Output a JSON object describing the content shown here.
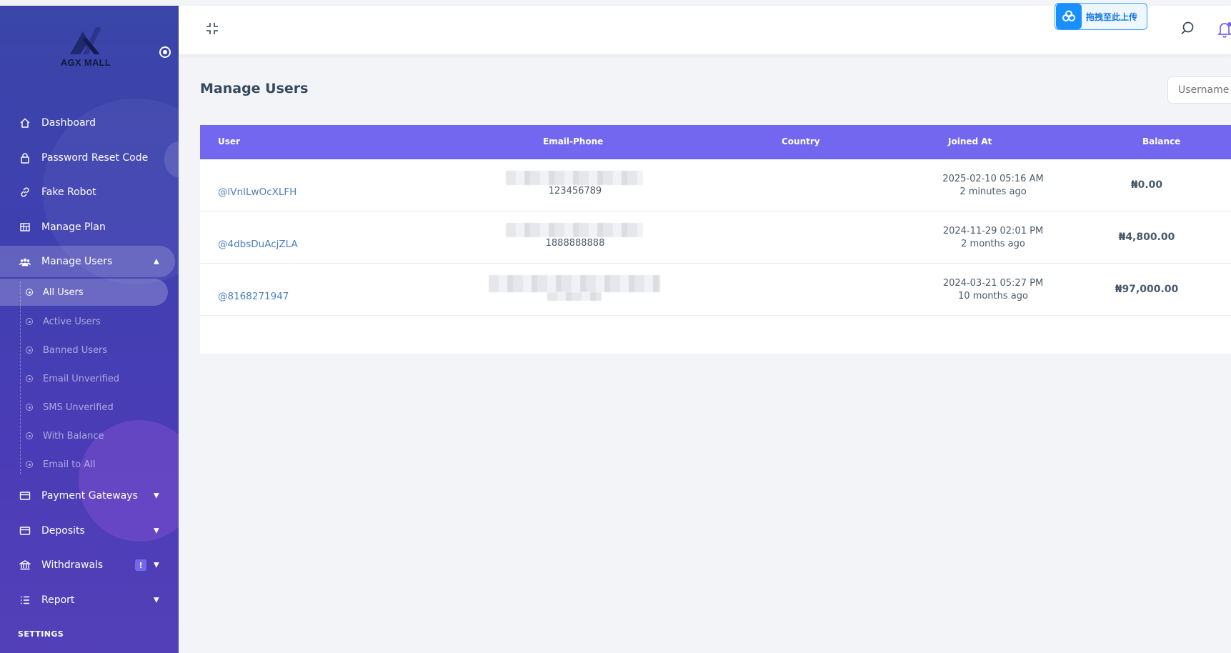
{
  "brand": {
    "name": "AGX MALL"
  },
  "sidebar": {
    "items": [
      {
        "label": "Dashboard",
        "icon": "home-icon"
      },
      {
        "label": "Password Reset Code",
        "icon": "lock-icon"
      },
      {
        "label": "Fake Robot",
        "icon": "link-icon"
      },
      {
        "label": "Manage Plan",
        "icon": "grid-icon"
      },
      {
        "label": "Manage Users",
        "icon": "users-icon",
        "expanded": true
      }
    ],
    "submenu": [
      {
        "label": "All Users",
        "active": true
      },
      {
        "label": "Active Users"
      },
      {
        "label": "Banned Users"
      },
      {
        "label": "Email Unverified"
      },
      {
        "label": "SMS Unverified"
      },
      {
        "label": "With Balance"
      },
      {
        "label": "Email to All"
      }
    ],
    "items_after": [
      {
        "label": "Payment Gateways",
        "icon": "credit-card-icon"
      },
      {
        "label": "Deposits",
        "icon": "wallet-icon"
      },
      {
        "label": "Withdrawals",
        "icon": "bank-icon",
        "badge": "!"
      },
      {
        "label": "Report",
        "icon": "list-icon"
      }
    ],
    "section_label": "SETTINGS"
  },
  "topbar": {
    "upload_label": "拖拽至此上传"
  },
  "page": {
    "title": "Manage Users",
    "search_placeholder": "Username"
  },
  "table": {
    "headers": [
      "User",
      "Email-Phone",
      "Country",
      "Joined At",
      "Balance"
    ],
    "rows": [
      {
        "user": "@lVnILwOcXLFH",
        "phone": "123456789",
        "joined": "2025-02-10 05:16 AM",
        "joined_ago": "2 minutes ago",
        "balance": "₦0.00"
      },
      {
        "user": "@4dbsDuAcjZLA",
        "phone": "1888888888",
        "joined": "2024-11-29 02:01 PM",
        "joined_ago": "2 months ago",
        "balance": "₦4,800.00"
      },
      {
        "user": "@8168271947",
        "phone": "",
        "joined": "2024-03-21 05:27 PM",
        "joined_ago": "10 months ago",
        "balance": "₦97,000.00"
      }
    ]
  },
  "colors": {
    "accent": "#7367f0",
    "sidebar_start": "#3a46a8",
    "sidebar_end": "#5340b8",
    "link": "#4a7fc1"
  }
}
